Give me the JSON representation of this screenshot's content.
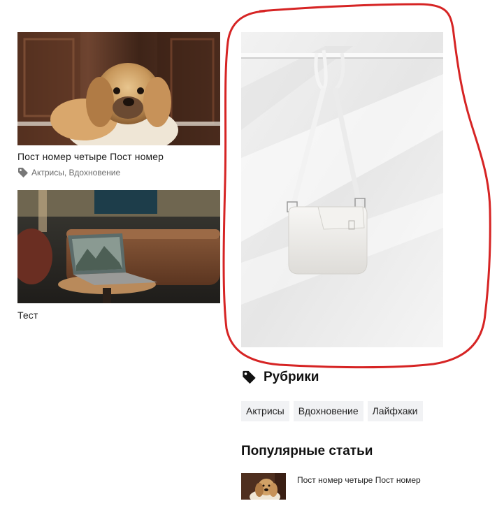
{
  "posts": [
    {
      "title": "Пост номер четыре Пост номер",
      "categories": [
        "Актрисы",
        "Вдохновение"
      ],
      "categories_text": "Актрисы, Вдохновение",
      "image": "dog-photo"
    },
    {
      "title": "Тест",
      "image": "laptop-photo"
    }
  ],
  "sidebar": {
    "banner_image": "white-bag-photo",
    "categories_widget": {
      "title": "Рубрики",
      "icon": "tag-icon",
      "tags": [
        "Актрисы",
        "Вдохновение",
        "Лайфхаки"
      ]
    },
    "popular_widget": {
      "title": "Популярные статьи",
      "items": [
        {
          "title": "Пост номер четыре Пост номер",
          "image": "dog-photo"
        }
      ]
    }
  },
  "annotation": {
    "color": "#d62424",
    "shape": "hand-drawn-outline"
  }
}
